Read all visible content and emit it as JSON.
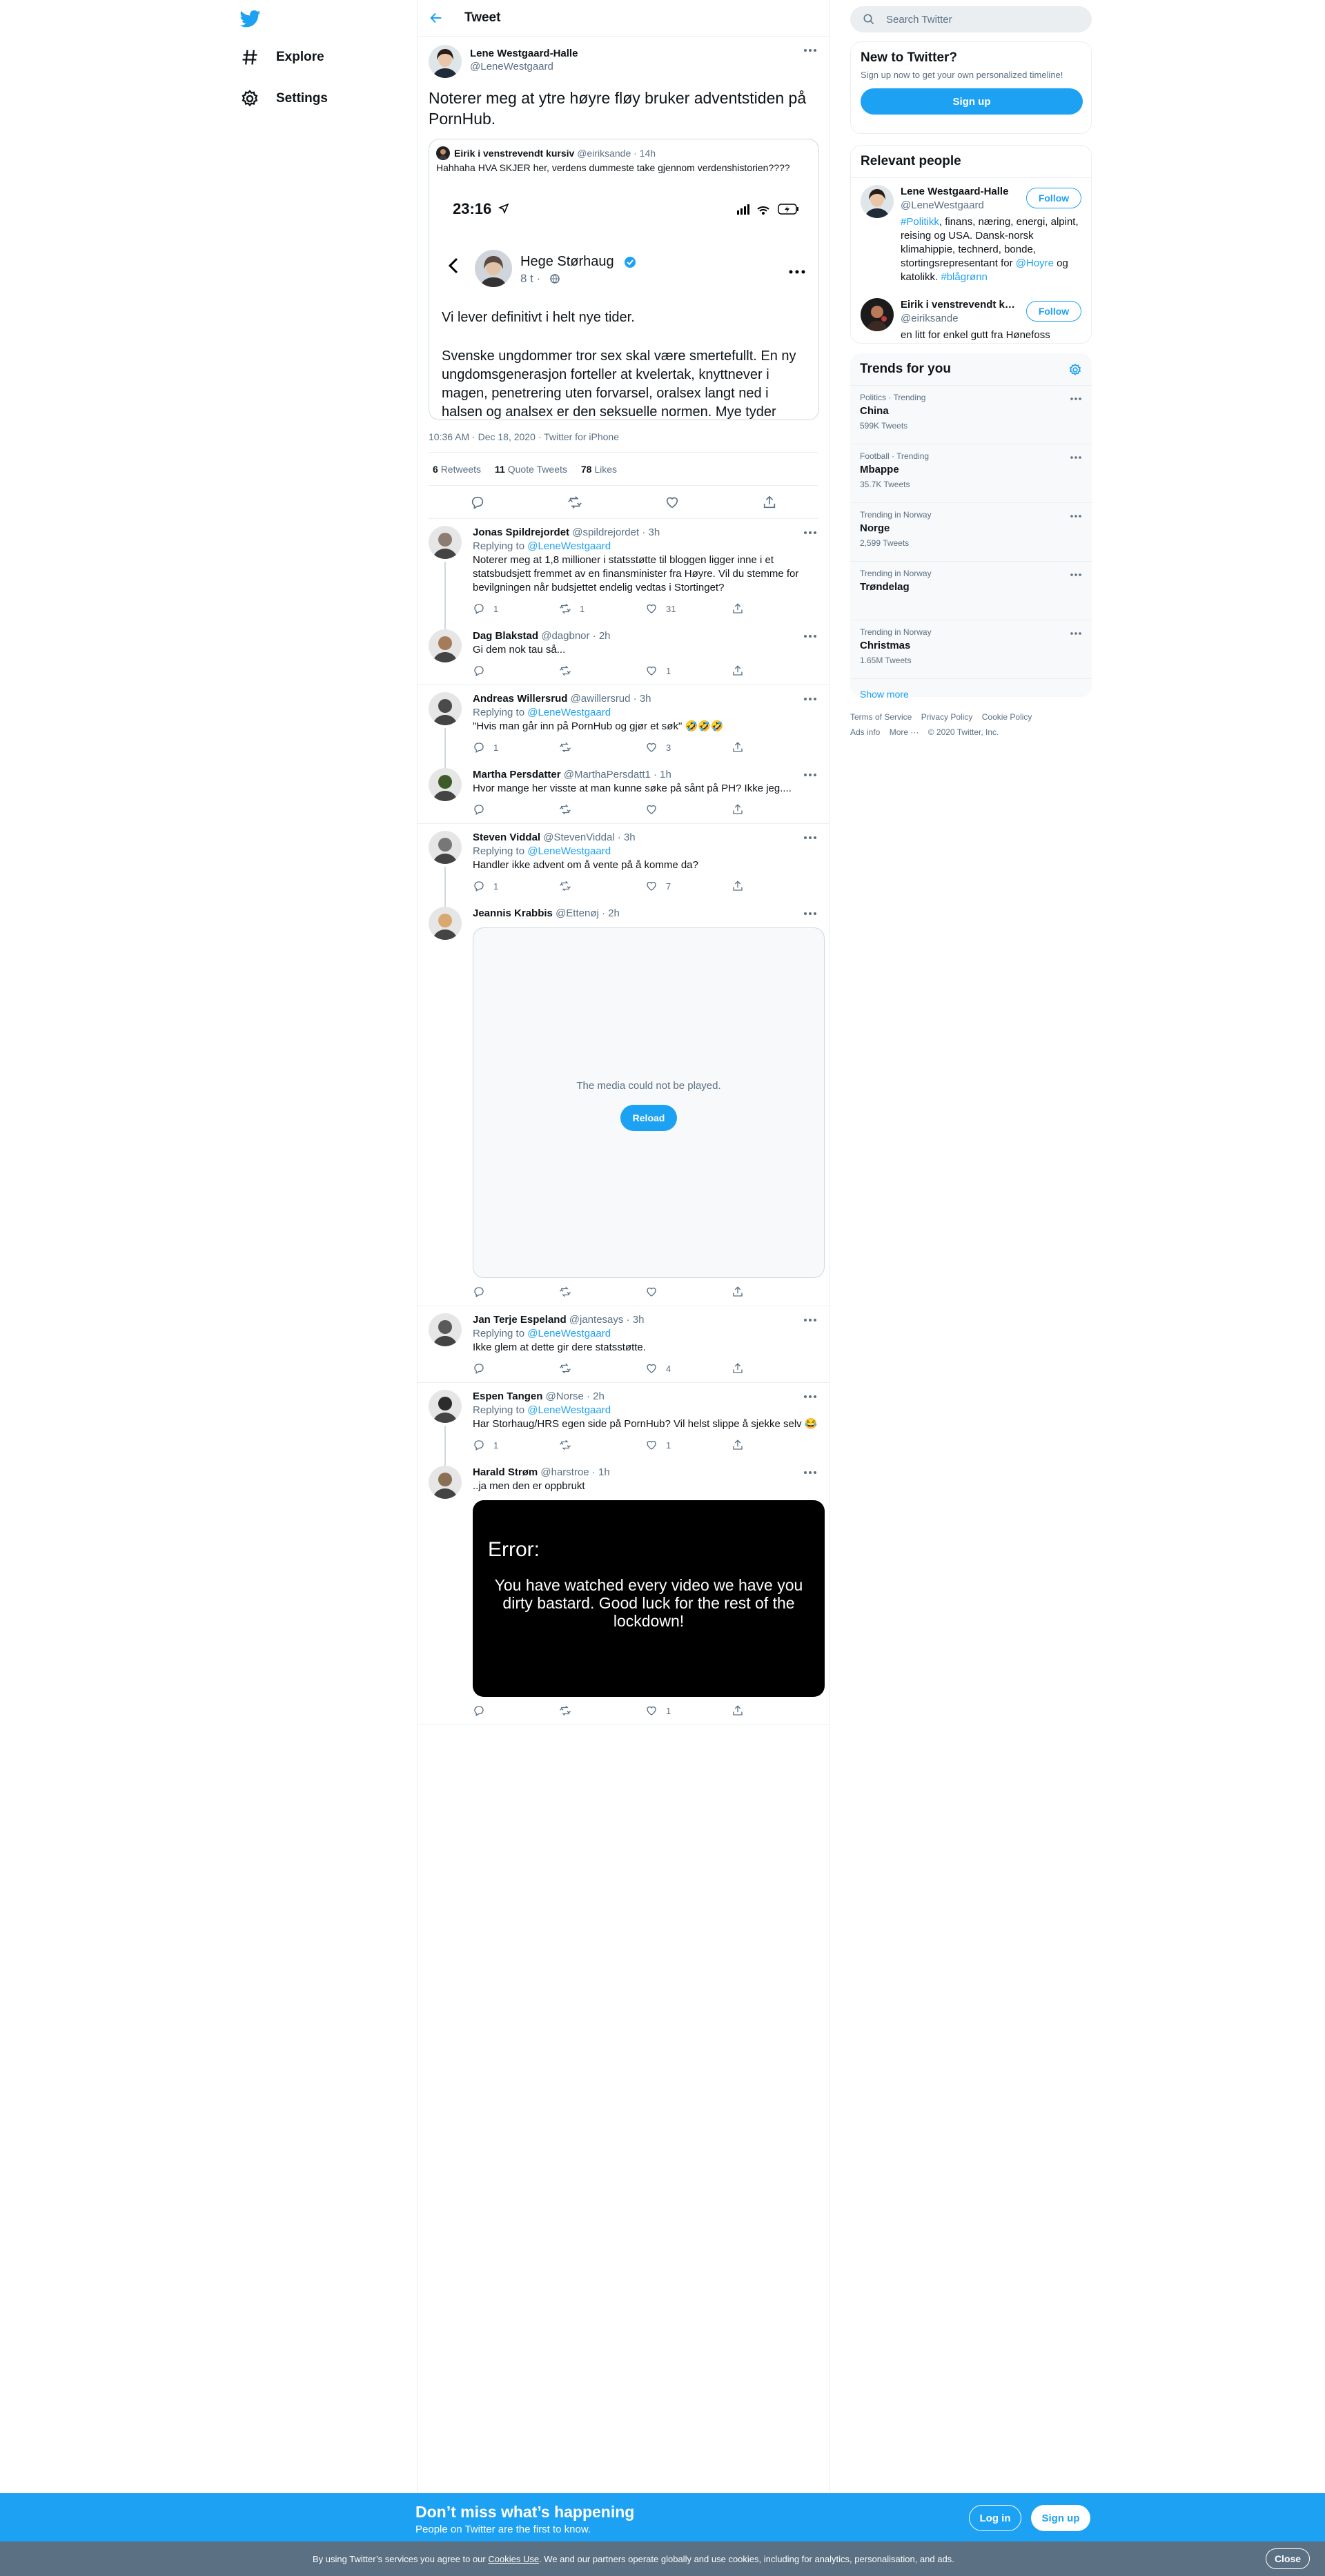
{
  "nav": {
    "items": [
      {
        "label": "Explore",
        "icon": "hashtag-icon"
      },
      {
        "label": "Settings",
        "icon": "gear-icon"
      }
    ]
  },
  "header": {
    "title": "Tweet"
  },
  "tweet": {
    "name": "Lene Westgaard-Halle",
    "handle": "@LeneWestgaard",
    "text": "Noterer meg at ytre høyre fløy bruker adventstiden på PornHub.",
    "quote": {
      "name": "Eirik i venstrevendt kursiv",
      "handle": "@eiriksande",
      "time": "· 14h",
      "text": "Hahhaha HVA SKJER her, verdens dummeste take gjennom verdenshistorien????",
      "phone": {
        "clock": "23:16",
        "author": "Hege Størhaug",
        "ago": "8 t ·",
        "line1": "Vi lever definitivt i helt nye tider.",
        "line2": "Svenske ungdommer tror sex skal være smertefullt. En ny ungdomsgenerasjon forteller at kvelertak, knyttnever i magen, penetrering uten forvarsel, oralsex langt ned i halsen og analsex er den seksuelle normen. Mye tyder"
      }
    },
    "meta": "10:36 AM · Dec 18, 2020 · Twitter for iPhone",
    "stats": [
      {
        "n": "6",
        "label": "Retweets"
      },
      {
        "n": "11",
        "label": "Quote Tweets"
      },
      {
        "n": "78",
        "label": "Likes"
      }
    ]
  },
  "replies": [
    {
      "name": "Jonas Spildrejordet",
      "handle": "@spildrejordet",
      "time": "· 3h",
      "replying": "@LeneWestgaard",
      "text": "Noterer meg at 1,8 millioner i statsstøtte til bloggen ligger inne i et statsbudsjett fremmet av en finansminister fra Høyre. Vil du stemme for bevilgningen når budsjettet endelig vedtas i Stortinget?",
      "counts": [
        "1",
        "1",
        "31",
        ""
      ]
    },
    {
      "name": "Dag Blakstad",
      "handle": "@dagbnor",
      "time": "· 2h",
      "replying": "",
      "text": "Gi dem nok tau så...",
      "counts": [
        "",
        "",
        "1",
        ""
      ]
    },
    {
      "name": "Andreas Willersrud",
      "handle": "@awillersrud",
      "time": "· 3h",
      "replying": "@LeneWestgaard",
      "text": "\"Hvis man går inn på PornHub og gjør et søk\" 🤣🤣🤣",
      "counts": [
        "1",
        "",
        "3",
        ""
      ]
    },
    {
      "name": "Martha Persdatter",
      "handle": "@MarthaPersdatt1",
      "time": "· 1h",
      "replying": "",
      "text": "Hvor mange her visste at man kunne søke på sånt på PH? Ikke jeg....",
      "counts": [
        "",
        "",
        "",
        ""
      ]
    },
    {
      "name": "Steven Viddal",
      "handle": "@StevenViddal",
      "time": "· 3h",
      "replying": "@LeneWestgaard",
      "text": "Handler ikke advent om å vente på å komme da?",
      "counts": [
        "1",
        "",
        "7",
        ""
      ]
    },
    {
      "name": "Jeannis Krabbis",
      "handle": "@Ettenøj",
      "time": "· 2h",
      "replying": "",
      "text": "",
      "media_msg": "The media could not be played.",
      "reload": "Reload",
      "counts": [
        "",
        "",
        "",
        ""
      ]
    },
    {
      "name": "Jan Terje Espeland",
      "handle": "@jantesays",
      "time": "· 3h",
      "replying": "@LeneWestgaard",
      "text": "Ikke glem at dette gir dere statsstøtte.",
      "counts": [
        "",
        "",
        "4",
        ""
      ]
    },
    {
      "name": "Espen Tangen",
      "handle": "@Norse",
      "time": "· 2h",
      "replying": "@LeneWestgaard",
      "text": "Har Storhaug/HRS egen side på PornHub? Vil helst slippe å sjekke selv 😂",
      "counts": [
        "1",
        "",
        "1",
        ""
      ]
    },
    {
      "name": "Harald Strøm",
      "handle": "@harstroe",
      "time": "· 1h",
      "replying": "",
      "text": "..ja men den er oppbrukt",
      "error_title": "Error:",
      "error_text": "You have watched every video we have you dirty bastard. Good luck for the rest of the lockdown!",
      "counts": [
        "",
        "",
        "1",
        ""
      ]
    }
  ],
  "replying_label": "Replying to",
  "right": {
    "search_placeholder": "Search Twitter",
    "new": {
      "title": "New to Twitter?",
      "sub": "Sign up now to get your own personalized timeline!",
      "button": "Sign up"
    },
    "relevant": {
      "title": "Relevant people",
      "follow": "Follow",
      "people": [
        {
          "name": "Lene Westgaard-Halle",
          "handle": "@LeneWestgaard",
          "bio_pre_link": "#Politikk",
          "bio_mid": ", finans, næring, energi, alpint, reising og USA. Dansk-norsk klimahippie, technerd, bonde, stortingsrepresentant for ",
          "bio_link2": "@Hoyre",
          "bio_mid2": " og katolikk. ",
          "bio_link3": "#blågrønn"
        },
        {
          "name": "Eirik i venstrevendt kursiv",
          "handle": "@eiriksande",
          "bio": "en litt for enkel gutt fra Hønefoss"
        }
      ]
    },
    "trends": {
      "title": "Trends for you",
      "items": [
        {
          "context": "Politics · Trending",
          "name": "China",
          "count": "599K Tweets"
        },
        {
          "context": "Football · Trending",
          "name": "Mbappe",
          "count": "35.7K Tweets"
        },
        {
          "context": "Trending in Norway",
          "name": "Norge",
          "count": "2,599 Tweets"
        },
        {
          "context": "Trending in Norway",
          "name": "Trøndelag",
          "count": ""
        },
        {
          "context": "Trending in Norway",
          "name": "Christmas",
          "count": "1.65M Tweets"
        }
      ],
      "show_more": "Show more"
    },
    "footer": [
      "Terms of Service",
      "Privacy Policy",
      "Cookie Policy",
      "Ads info",
      "More ···",
      "© 2020 Twitter, Inc."
    ]
  },
  "bottom": {
    "headline": "Don’t miss what’s happening",
    "sub": "People on Twitter are the first to know.",
    "login": "Log in",
    "signup": "Sign up"
  },
  "cookie": {
    "pre": "By using Twitter’s services you agree to our ",
    "link": "Cookies Use",
    "post": ". We and our partners operate globally and use cookies, including for analytics, personalisation, and ads.",
    "close": "Close"
  },
  "colors": {
    "accent": "#1da1f2",
    "secondary_text": "#5b7083",
    "border": "#ebeef0",
    "cookie_bar": "#5b7083"
  }
}
